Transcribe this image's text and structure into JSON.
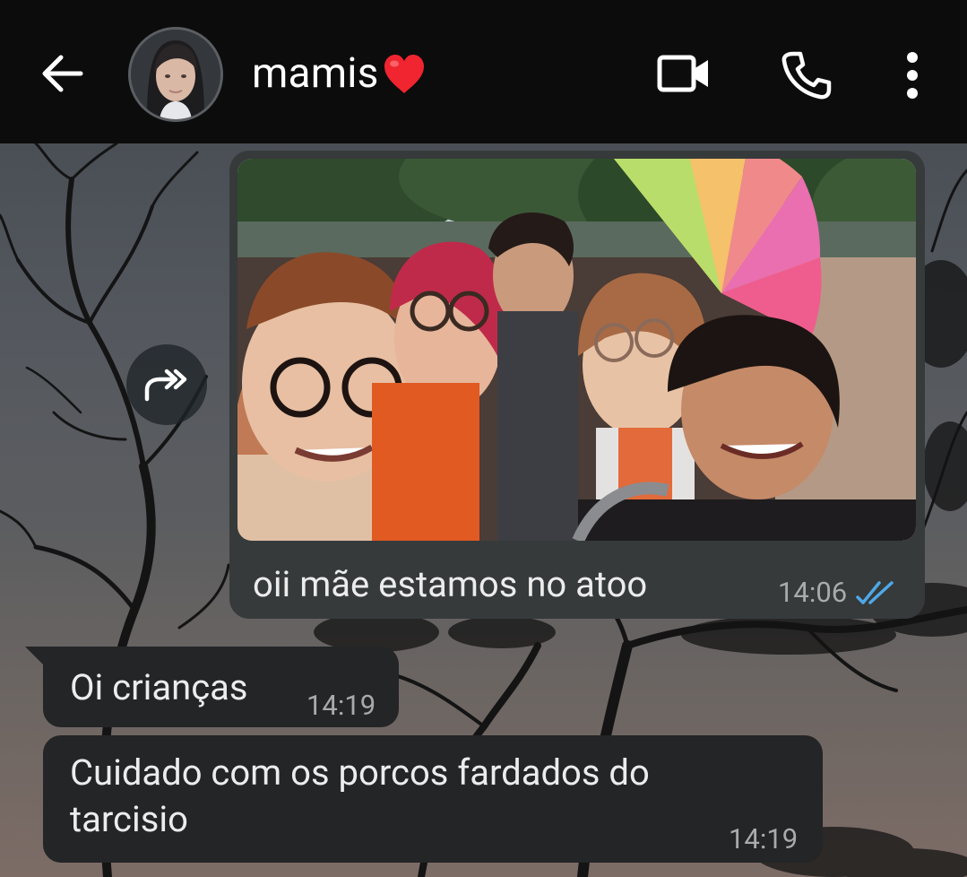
{
  "header": {
    "contact_name": "mamis",
    "contact_emoji": "❤️",
    "icons": [
      "back-arrow-icon",
      "avatar",
      "video-call-icon",
      "voice-call-icon",
      "more-options-icon"
    ]
  },
  "messages": [
    {
      "direction": "outgoing",
      "type": "image",
      "caption": "oii mãe estamos no atoo",
      "time": "14:06",
      "status": "read",
      "status_icon": "double-check-icon"
    },
    {
      "direction": "incoming",
      "text": "Oi crianças",
      "time": "14:19"
    },
    {
      "direction": "incoming",
      "text": "Cuidado com os porcos fardados do tarcisio",
      "time": "14:19"
    }
  ],
  "forward_icon": "forward-icon",
  "colors": {
    "header_bg": "#0c0c0c",
    "incoming_bubble": "#232526",
    "outgoing_bubble": "#363a3b",
    "read_tick": "#4fa8e8",
    "text": "#ececec",
    "meta_text": "#a7abad"
  }
}
